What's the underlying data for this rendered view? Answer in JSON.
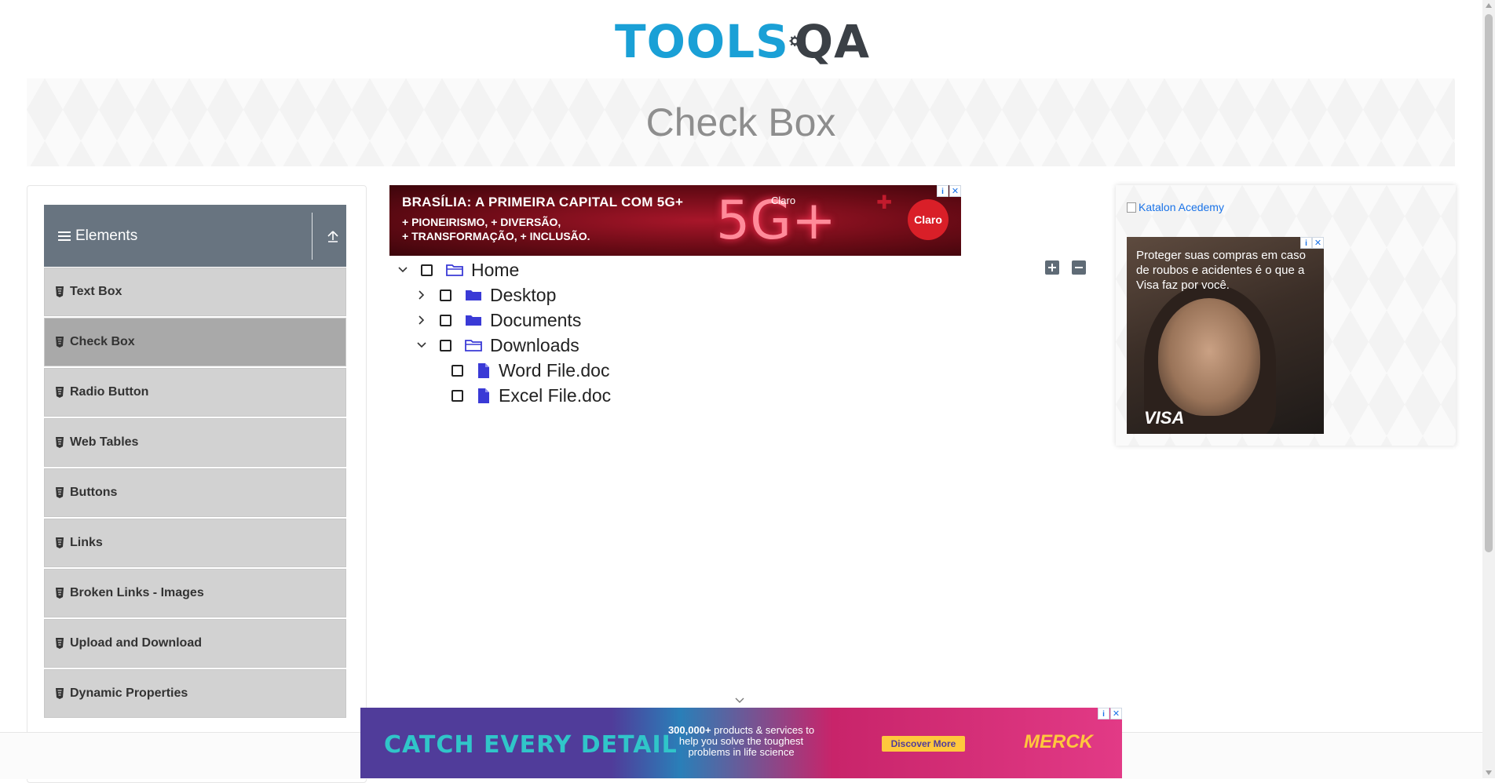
{
  "logo": {
    "part1": "TOOLS",
    "part2": "QA"
  },
  "banner": {
    "title": "Check Box"
  },
  "sidebar": {
    "group_title": "Elements",
    "items": [
      {
        "label": "Text Box",
        "active": false
      },
      {
        "label": "Check Box",
        "active": true
      },
      {
        "label": "Radio Button",
        "active": false
      },
      {
        "label": "Web Tables",
        "active": false
      },
      {
        "label": "Buttons",
        "active": false
      },
      {
        "label": "Links",
        "active": false
      },
      {
        "label": "Broken Links - Images",
        "active": false
      },
      {
        "label": "Upload and Download",
        "active": false
      },
      {
        "label": "Dynamic Properties",
        "active": false
      }
    ]
  },
  "ad_top": {
    "headline": "BRASÍLIA: A PRIMEIRA CAPITAL COM 5G+",
    "line1": "+ PIONEIRISMO, + DIVERSÃO,",
    "line2": "+ TRANSFORMAÇÃO, + INCLUSÃO.",
    "big": "5G+",
    "brand": "Claro",
    "logo": "Claro",
    "info": "i",
    "close": "✕"
  },
  "tree": {
    "home": {
      "label": "Home",
      "expanded": true,
      "checked": false
    },
    "desktop": {
      "label": "Desktop",
      "expanded": false,
      "checked": false
    },
    "documents": {
      "label": "Documents",
      "expanded": false,
      "checked": false
    },
    "downloads": {
      "label": "Downloads",
      "expanded": true,
      "checked": false
    },
    "word": {
      "label": "Word File.doc",
      "checked": false
    },
    "excel": {
      "label": "Excel File.doc",
      "checked": false
    }
  },
  "right_ad": {
    "katalon_alt": "Katalon Acedemy",
    "visa_text": "Proteger suas compras em caso de roubos e acidentes é o que a Visa faz por você.",
    "visa_logo": "VISA",
    "info": "i",
    "close": "✕"
  },
  "ad_bottom": {
    "catch": "CATCH EVERY DETAIL",
    "desc_bold": "300,000+",
    "desc_rest": " products & services to help you solve the toughest problems in life science",
    "button": "Discover More",
    "brand": "MERCK",
    "info": "i",
    "close": "✕"
  },
  "colors": {
    "accent": "#1aa0d6",
    "header_bg": "#687480",
    "menu_bg": "#d2d2d2",
    "menu_active": "#a9a9a9",
    "folder": "#3a3ad6"
  }
}
